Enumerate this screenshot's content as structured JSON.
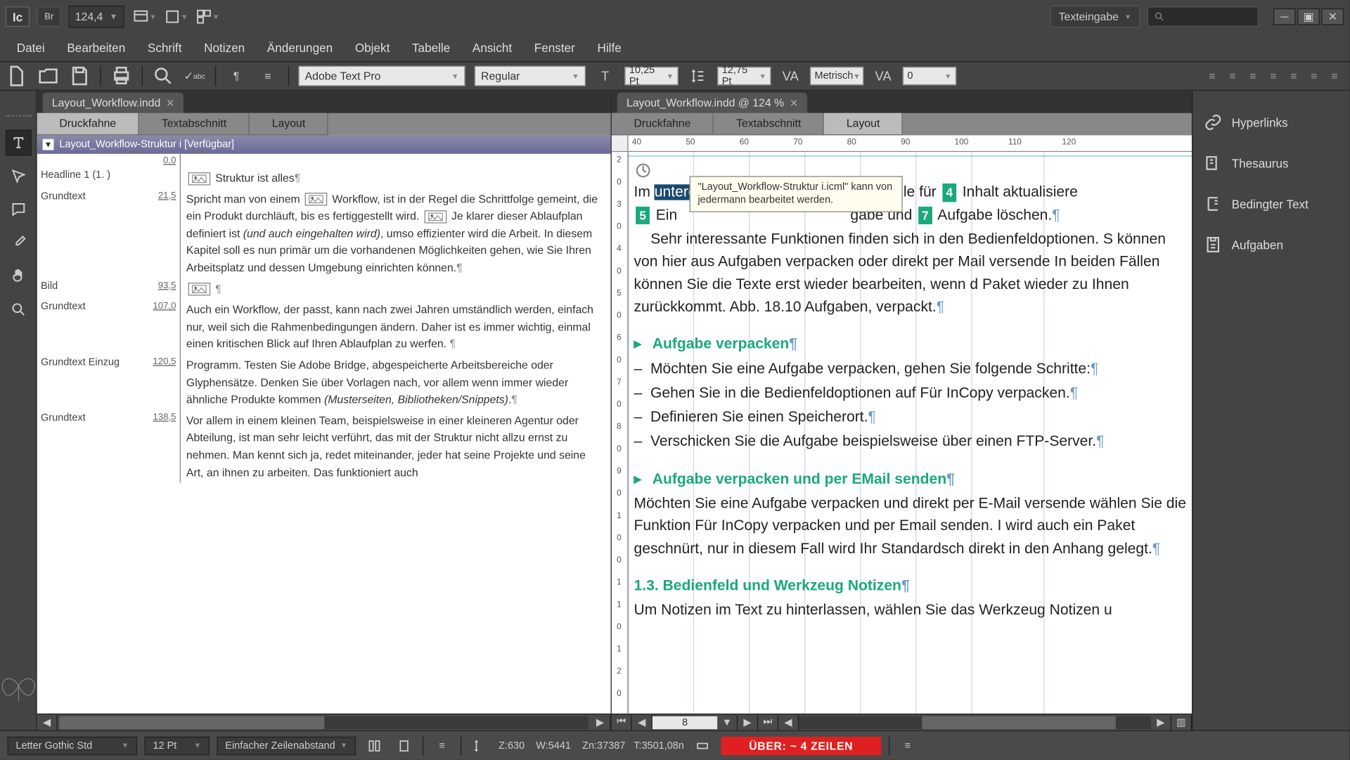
{
  "titlebar": {
    "logo": "Ic",
    "bridge": "Br",
    "zoom": "124,4"
  },
  "workspace": {
    "label": "Texteingabe"
  },
  "menu": {
    "file": "Datei",
    "edit": "Bearbeiten",
    "type": "Schrift",
    "notes": "Notizen",
    "changes": "Änderungen",
    "object": "Objekt",
    "table": "Tabelle",
    "view": "Ansicht",
    "window": "Fenster",
    "help": "Hilfe"
  },
  "control": {
    "font": "Adobe Text Pro",
    "style": "Regular",
    "size": "10,25 Pt",
    "leading": "12,75 Pt",
    "kerning": "Metrisch",
    "tracking": "0"
  },
  "leftDoc": {
    "tab": "Layout_Workflow.indd",
    "views": {
      "druckfahne": "Druckfahne",
      "textabschnitt": "Textabschnitt",
      "layout": "Layout"
    },
    "assignment": "Layout_Workflow-Struktur i [Verfügbar]",
    "rows": [
      {
        "style": "",
        "depth": "0,0",
        "text": ""
      },
      {
        "style": "Headline 1 (1. )",
        "depth": "",
        "text": "Struktur ist alles¶"
      },
      {
        "style": "Grundtext",
        "depth": "",
        "text": "Spricht man von einem [img] Workflow, ist in der Regel die Schrittfolge gemeint, die ein Produkt durchläuft, bis es fertiggestellt wird. [img] Je klarer dieser Ablaufplan definiert ist |i|(und auch eingehalten wird)|/i|, umso effizienter wird die Arbeit. In diesem Kapitel soll es nun primär um die vorhandenen Möglichkeiten gehen, wie Sie Ihren Arbeitsplatz und dessen Umgebung einrichten können.¶",
        "depth2": "21,5"
      },
      {
        "style": "Bild",
        "depth": "93,5",
        "text": "[img] ¶"
      },
      {
        "style": "Grundtext",
        "depth": "",
        "text": "Auch ein Workflow, der passt, kann nach zwei Jahren umständlich werden, einfach nur, weil sich die Rahmenbedingungen ändern. Daher ist es immer wichtig, einmal einen kritischen Blick auf Ihren Ablaufplan zu werfen. ¶",
        "depth2": "107,0"
      },
      {
        "style": "Grundtext Einzug",
        "depth": "",
        "text": "Programm. Testen Sie Adobe Bridge, abgespeicherte Arbeitsbereiche oder Glyphensätze. Denken Sie über Vorlagen nach, vor allem wenn immer wieder ähnliche Produkte kommen |i|(Musterseiten, Bibliotheken/Snippets)|/i|.¶",
        "depth2": "120,5"
      },
      {
        "style": "Grundtext",
        "depth": "138,5",
        "text": "Vor allem in einem kleinen Team, beispielsweise in einer kleineren Agentur oder Abteilung, ist man sehr leicht verführt, das mit der Struktur nicht allzu ernst zu nehmen. Man kennt sich ja, redet miteinander, jeder hat seine Projekte und seine Art, an ihnen zu arbeiten. Das funktioniert auch"
      }
    ]
  },
  "rightDoc": {
    "tab": "Layout_Workflow.indd @ 124 %",
    "views": {
      "druckfahne": "Druckfahne",
      "textabschnitt": "Textabschnitt",
      "layout": "Layout"
    },
    "rulerTicks": [
      "40",
      "45",
      "50",
      "55",
      "60",
      "65",
      "70",
      "75",
      "80",
      "85",
      "90",
      "95",
      "100",
      "105",
      "110",
      "115",
      "120",
      "125",
      "130"
    ],
    "rulerLabels": [
      "40",
      "50",
      "60",
      "70",
      "80",
      "90",
      "100",
      "110",
      "120"
    ],
    "vruler": [
      "2",
      "0",
      "3",
      "0",
      "4",
      "0",
      "5",
      "0",
      "6",
      "0",
      "7",
      "0",
      "8",
      "0",
      "9",
      "0",
      "1",
      "0",
      "0",
      "1",
      "1",
      "0",
      "1",
      "2",
      "0"
    ],
    "tooltip": "\"Layout_Workflow-Struktur i.icml\" kann von jedermann bearbeitet werden.",
    "p1_a": "Im ",
    "p1_sel": "unteren",
    "p1_b": " Bereich finden Sie die Symbole für ",
    "p1_c": " Inhalt aktualisiere",
    "p1_d": " Ein",
    "p1_e": "gabe und ",
    "p1_f": " Aufgabe löschen.",
    "p2": "Sehr interessante Funktionen finden sich in den Bedienfeldoptionen. S können von hier aus Aufgaben verpacken oder direkt per Mail versende In beiden Fällen können Sie die Texte erst wieder bearbeiten, wenn d Paket wieder zu Ihnen zurückkommt. Abb. 18.10 Aufgaben, verpackt.",
    "h1": "Aufgabe verpacken",
    "l1": "Möchten Sie eine Aufgabe verpacken, gehen Sie folgende Schritte:",
    "l2": "Gehen Sie in die Bedienfeldoptionen auf Für InCopy verpacken.",
    "l3": "Definieren Sie einen Speicherort.",
    "l4": "Verschicken Sie die Aufgabe beispielsweise über einen FTP-Server.",
    "h2": "Aufgabe verpacken und per EMail senden",
    "p3": "Möchten Sie eine Aufgabe verpacken und direkt per E-Mail versende wählen Sie die Funktion Für InCopy verpacken und per Email senden. I wird auch ein Paket geschnürt, nur in diesem Fall wird Ihr Standardsch direkt in den Anhang gelegt.",
    "h3": "1.3.  Bedienfeld und Werkzeug Notizen",
    "p4": "Um Notizen im Text zu hinterlassen, wählen Sie das Werkzeug Notizen u",
    "pageNum": "8",
    "badges": {
      "b4": "4",
      "b5": "5",
      "b7": "7"
    }
  },
  "panels": {
    "hyperlinks": "Hyperlinks",
    "thesaurus": "Thesaurus",
    "conditional": "Bedingter Text",
    "assignments": "Aufgaben"
  },
  "status": {
    "font": "Letter Gothic Std",
    "size": "12 Pt",
    "leading": "Einfacher Zeilenabstand",
    "info": "Z:630    W:5441    Zn:37387   T:3501,08n",
    "alert": "ÜBER:  ~ 4 ZEILEN"
  }
}
